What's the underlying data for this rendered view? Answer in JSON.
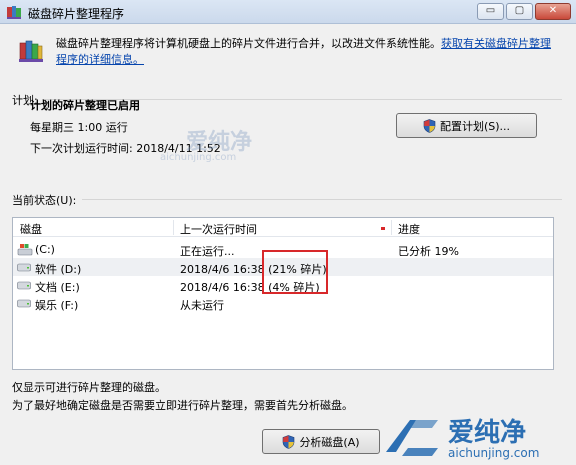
{
  "window": {
    "title": "磁盘碎片整理程序",
    "minimize_label": "▭",
    "maximize_label": "▢",
    "close_label": "✕"
  },
  "intro": {
    "text": "磁盘碎片整理程序将计算机硬盘上的碎片文件进行合并，以改进文件系统性能。",
    "link": "获取有关磁盘碎片整理程序的详细信息。"
  },
  "schedule": {
    "section_label": "计划:",
    "status": "计划的碎片整理已启用",
    "frequency": "每星期三 1:00 运行",
    "next_run": "下一次计划运行时间: 2018/4/11 1:52",
    "configure_button": "配置计划(S)..."
  },
  "current_status": {
    "section_label": "当前状态(U):",
    "columns": {
      "disk": "磁盘",
      "last_run": "上一次运行时间",
      "progress": "进度"
    },
    "rows": [
      {
        "disk": "(C:)",
        "last_run": "正在运行...",
        "progress": "已分析 19%"
      },
      {
        "disk": "软件 (D:)",
        "last_run": "2018/4/6 16:38 (21% 碎片)",
        "progress": ""
      },
      {
        "disk": "文档 (E:)",
        "last_run": "2018/4/6 16:38 (4% 碎片)",
        "progress": ""
      },
      {
        "disk": "娱乐 (F:)",
        "last_run": "从未运行",
        "progress": ""
      }
    ]
  },
  "footer": {
    "note1": "仅显示可进行碎片整理的磁盘。",
    "note2": "为了最好地确定磁盘是否需要立即进行碎片整理，需要首先分析磁盘。",
    "analyze_button": "分析磁盘(A)"
  },
  "watermark": {
    "center_cn": "爱纯净",
    "center_en": "aichunjing.com",
    "logo_cn": "爱纯净",
    "logo_en": "aichunjing.com"
  },
  "colors": {
    "link": "#0645ad",
    "highlight_box": "#d8282a",
    "brand": "#2c6fb3"
  }
}
